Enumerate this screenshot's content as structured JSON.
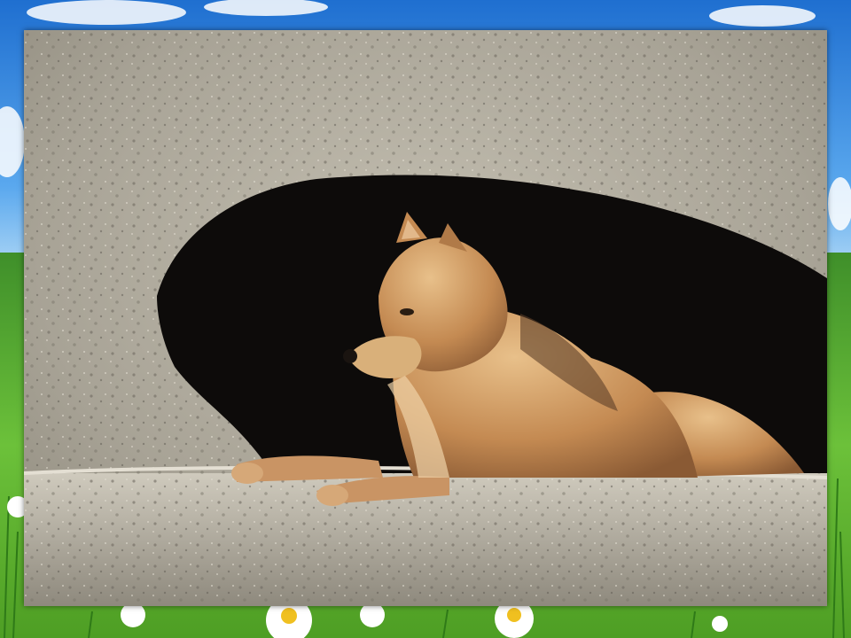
{
  "slide": {
    "background": {
      "sky_color": "#2f7fd8",
      "grass_color": "#5fb030",
      "flower_icon": "daisy-icon"
    },
    "photo": {
      "subject_icon": "wolf-icon",
      "rock_color": "#b8b2a4",
      "cave_color": "#0d0b0a",
      "fur_color": "#c8955a"
    }
  }
}
